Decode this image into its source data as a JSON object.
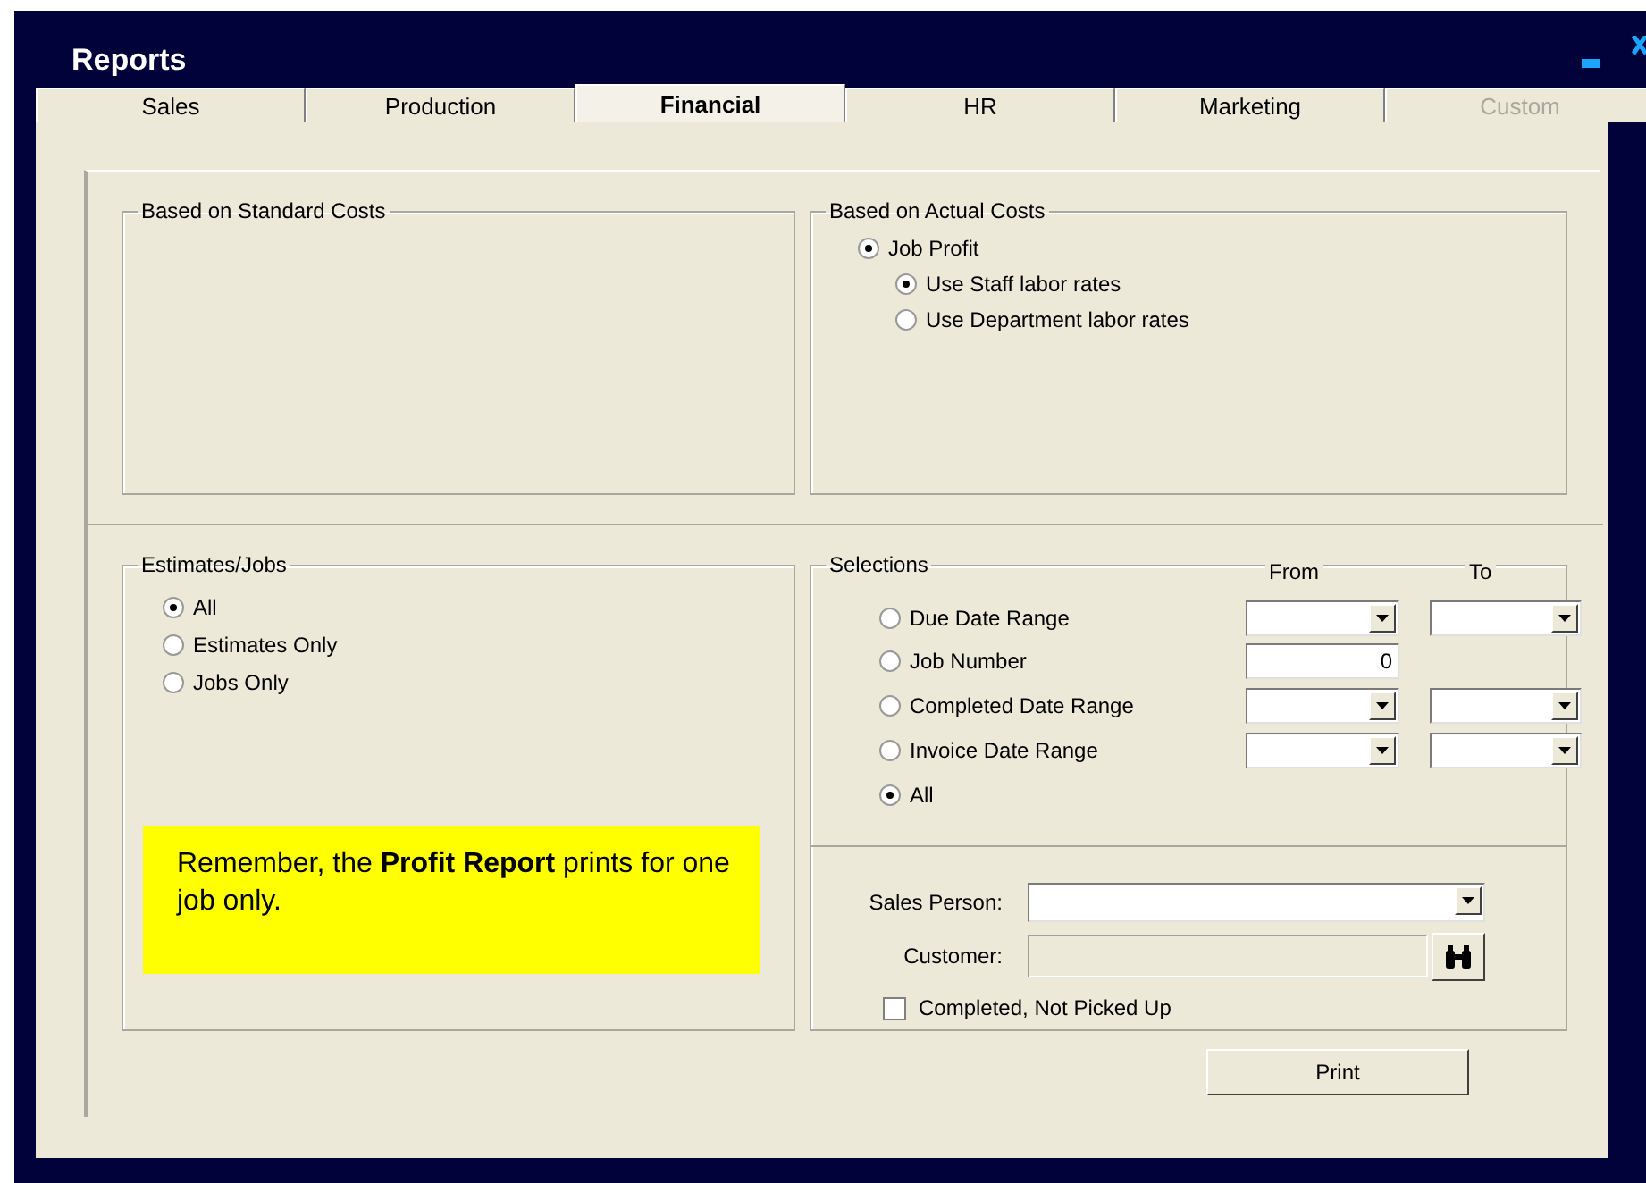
{
  "window": {
    "title": "Reports"
  },
  "tabs": [
    {
      "label": "Sales",
      "selected": false,
      "disabled": false
    },
    {
      "label": "Production",
      "selected": false,
      "disabled": false
    },
    {
      "label": "Financial",
      "selected": true,
      "disabled": false
    },
    {
      "label": "HR",
      "selected": false,
      "disabled": false
    },
    {
      "label": "Marketing",
      "selected": false,
      "disabled": false
    },
    {
      "label": "Custom",
      "selected": false,
      "disabled": true
    }
  ],
  "standard_costs": {
    "title": "Based on Standard Costs"
  },
  "actual_costs": {
    "title": "Based on Actual Costs",
    "options": [
      {
        "label": "Job Profit",
        "selected": true,
        "children": [
          {
            "label": "Use Staff labor rates",
            "selected": true
          },
          {
            "label": "Use Department labor rates",
            "selected": false
          }
        ]
      }
    ]
  },
  "estimates_jobs": {
    "title": "Estimates/Jobs",
    "options": [
      {
        "label": "All",
        "selected": true
      },
      {
        "label": "Estimates Only",
        "selected": false
      },
      {
        "label": "Jobs Only",
        "selected": false
      }
    ]
  },
  "note": "Remember, the **Profit Report** prints for one job only.",
  "selections": {
    "title": "Selections",
    "from_label": "From",
    "to_label": "To",
    "options": [
      {
        "label": "Due Date Range",
        "selected": false,
        "kind": "range"
      },
      {
        "label": "Job Number",
        "selected": false,
        "kind": "number",
        "value": "0"
      },
      {
        "label": "Completed Date Range",
        "selected": false,
        "kind": "range"
      },
      {
        "label": "Invoice Date Range",
        "selected": false,
        "kind": "range"
      },
      {
        "label": "All",
        "selected": true,
        "kind": "plain"
      }
    ]
  },
  "sales_person": {
    "label": "Sales Person:"
  },
  "customer": {
    "label": "Customer:"
  },
  "completed_not_picked_up": {
    "label": "Completed, Not Picked Up",
    "checked": false
  },
  "print_button": {
    "label": "Print"
  }
}
